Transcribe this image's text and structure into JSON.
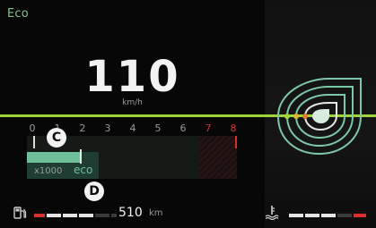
{
  "header": {
    "mode": "Eco"
  },
  "speed": {
    "value": "110",
    "unit": "km/h"
  },
  "rpm": {
    "ticks": [
      "0",
      "1",
      "2",
      "3",
      "4",
      "5",
      "6",
      "7",
      "8"
    ],
    "red_from_tick": "7",
    "multiplier": "x1000",
    "eco_label": "eco",
    "current_fraction_of_scale": 0.25
  },
  "callouts": {
    "c": "C",
    "d": "D"
  },
  "fuel": {
    "range_value": "510",
    "range_unit": "km",
    "level_fraction": 0.6
  },
  "temperature": {
    "level_fraction": 0.7
  },
  "colors": {
    "accent_green": "#9ed53b",
    "eco_green": "#6fbf9a",
    "warning_red": "#d9302b"
  },
  "icons": {
    "fuel": "fuel-pump-icon",
    "temperature": "coolant-temperature-icon",
    "eco_diagram": "eco-leaf-icon"
  }
}
